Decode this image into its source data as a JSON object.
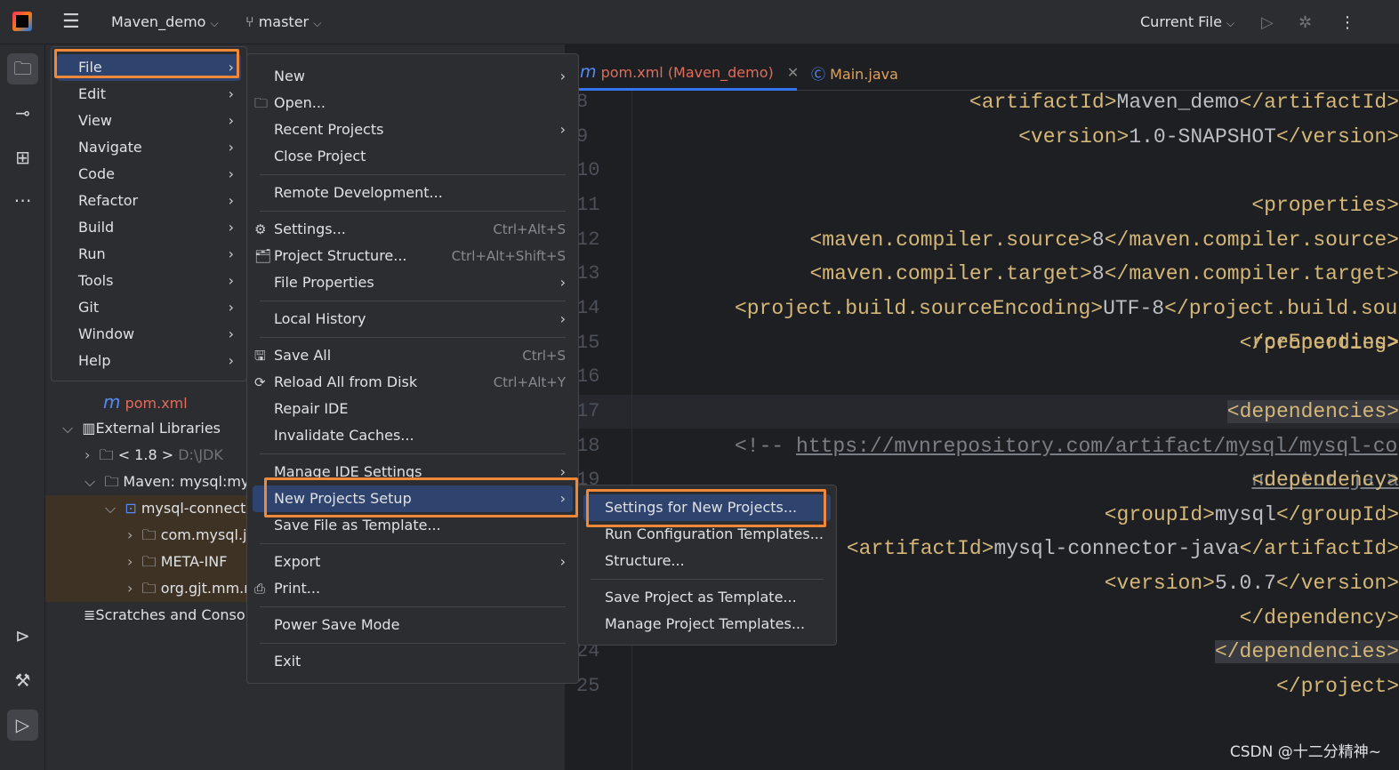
{
  "titlebar": {
    "project": "Maven_demo",
    "branch": "master",
    "run_config": "Current File"
  },
  "tree": {
    "pom": "pom.xml",
    "external": "External Libraries",
    "jdk": "< 1.8 >",
    "jdk_path": "D:\\JDK",
    "maven": "Maven: mysql:mys",
    "connector": "mysql-connect",
    "pkg1": "com.mysql.j",
    "pkg2": "META-INF",
    "pkg3": "org.gjt.mm.r",
    "scratches": "Scratches and Conso"
  },
  "tabs": [
    {
      "label": "pom.xml (Maven_demo)",
      "color": "#e06c5c"
    },
    {
      "label": "Main.java",
      "color": "#e0a060"
    }
  ],
  "code": [
    {
      "n": "8",
      "lvl": 1,
      "seg": [
        [
          "tag",
          "<artifactId>"
        ],
        [
          "txt",
          "Maven_demo"
        ],
        [
          "tag",
          "</artifactId>"
        ]
      ]
    },
    {
      "n": "9",
      "lvl": 1,
      "seg": [
        [
          "tag",
          "<version>"
        ],
        [
          "txt",
          "1.0-SNAPSHOT"
        ],
        [
          "tag",
          "</version>"
        ]
      ]
    },
    {
      "n": "10",
      "lvl": 0,
      "seg": []
    },
    {
      "n": "11",
      "lvl": 1,
      "seg": [
        [
          "tag",
          "<properties>"
        ]
      ]
    },
    {
      "n": "12",
      "lvl": 2,
      "seg": [
        [
          "tag",
          "<maven.compiler.source>"
        ],
        [
          "txt",
          "8"
        ],
        [
          "tag",
          "</maven.compiler.source>"
        ]
      ]
    },
    {
      "n": "13",
      "lvl": 2,
      "seg": [
        [
          "tag",
          "<maven.compiler.target>"
        ],
        [
          "txt",
          "8"
        ],
        [
          "tag",
          "</maven.compiler.target>"
        ]
      ]
    },
    {
      "n": "14",
      "lvl": 2,
      "seg": [
        [
          "tag",
          "<project.build.sourceEncoding>"
        ],
        [
          "txt",
          "UTF-8"
        ],
        [
          "tag",
          "</project.build.sourceEncoding>"
        ]
      ]
    },
    {
      "n": "15",
      "lvl": 1,
      "seg": [
        [
          "tag",
          "</properties>"
        ]
      ]
    },
    {
      "n": "16",
      "lvl": 0,
      "seg": []
    },
    {
      "n": "17",
      "lvl": 1,
      "seg": [
        [
          "tag",
          "<dependencies>"
        ]
      ]
    },
    {
      "n": "18",
      "lvl": 2,
      "seg": [
        [
          "cmt",
          "<!-- "
        ],
        [
          "url",
          "https://mvnrepository.com/artifact/mysql/mysql-connector-java"
        ]
      ]
    },
    {
      "n": "19",
      "lvl": 2,
      "seg": [
        [
          "tag",
          "<dependency>"
        ]
      ]
    },
    {
      "n": "20",
      "lvl": 3,
      "seg": [
        [
          "tag",
          "<groupId>"
        ],
        [
          "txt",
          "mysql"
        ],
        [
          "tag",
          "</groupId>"
        ]
      ]
    },
    {
      "n": "21",
      "lvl": 3,
      "seg": [
        [
          "tag",
          "<artifactId>"
        ],
        [
          "txt",
          "mysql-connector-java"
        ],
        [
          "tag",
          "</artifactId>"
        ]
      ]
    },
    {
      "n": "22",
      "lvl": 3,
      "seg": [
        [
          "tag",
          "<version>"
        ],
        [
          "txt",
          "5.0.7"
        ],
        [
          "tag",
          "</version>"
        ]
      ]
    },
    {
      "n": "23",
      "lvl": 2,
      "seg": [
        [
          "tag",
          "</dependency>"
        ]
      ]
    },
    {
      "n": "24",
      "lvl": 1,
      "seg": [
        [
          "tag",
          "</dependencies>"
        ]
      ]
    },
    {
      "n": "25",
      "lvl": 0,
      "seg": [
        [
          "tag",
          "</project>"
        ]
      ]
    }
  ],
  "main_menu": [
    "File",
    "Edit",
    "View",
    "Navigate",
    "Code",
    "Refactor",
    "Build",
    "Run",
    "Tools",
    "Git",
    "Window",
    "Help"
  ],
  "file_menu": [
    {
      "label": "New",
      "arrow": true
    },
    {
      "label": "Open...",
      "icon": "folder-icon"
    },
    {
      "label": "Recent Projects",
      "arrow": true
    },
    {
      "label": "Close Project"
    },
    {
      "sep": true
    },
    {
      "label": "Remote Development..."
    },
    {
      "sep": true
    },
    {
      "label": "Settings...",
      "icon": "gear-icon",
      "shortcut": "Ctrl+Alt+S"
    },
    {
      "label": "Project Structure...",
      "icon": "project-structure-icon",
      "shortcut": "Ctrl+Alt+Shift+S"
    },
    {
      "label": "File Properties",
      "arrow": true
    },
    {
      "sep": true
    },
    {
      "label": "Local History",
      "arrow": true
    },
    {
      "sep": true
    },
    {
      "label": "Save All",
      "icon": "save-icon",
      "shortcut": "Ctrl+S"
    },
    {
      "label": "Reload All from Disk",
      "icon": "reload-icon",
      "shortcut": "Ctrl+Alt+Y"
    },
    {
      "label": "Repair IDE"
    },
    {
      "label": "Invalidate Caches..."
    },
    {
      "sep": true
    },
    {
      "label": "Manage IDE Settings",
      "arrow": true
    },
    {
      "label": "New Projects Setup",
      "arrow": true,
      "selected": true
    },
    {
      "label": "Save File as Template..."
    },
    {
      "sep": true
    },
    {
      "label": "Export",
      "arrow": true
    },
    {
      "label": "Print...",
      "icon": "print-icon"
    },
    {
      "sep": true
    },
    {
      "label": "Power Save Mode"
    },
    {
      "sep": true
    },
    {
      "label": "Exit"
    }
  ],
  "setup_menu": [
    {
      "label": "Settings for New Projects...",
      "selected": true
    },
    {
      "label": "Run Configuration Templates..."
    },
    {
      "label": "Structure..."
    },
    {
      "sep": true
    },
    {
      "label": "Save Project as Template..."
    },
    {
      "label": "Manage Project Templates..."
    }
  ],
  "watermark": "CSDN @十二分精神~",
  "colors": {
    "accent": "#2e436e",
    "highlight": "#f0883a"
  }
}
